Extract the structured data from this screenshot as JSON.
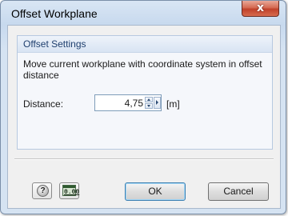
{
  "window": {
    "title": "Offset Workplane",
    "close_glyph": "x"
  },
  "group": {
    "title": "Offset Settings",
    "description": "Move current workplane with coordinate system in offset distance"
  },
  "distance": {
    "label": "Distance:",
    "value": "4,75",
    "unit": "[m]"
  },
  "buttons": {
    "help_icon": "help-icon",
    "help_glyph": "?",
    "calculator_icon": "calculator-icon",
    "calculator_text": "0.00",
    "ok": "OK",
    "cancel": "Cancel"
  },
  "colors": {
    "title_bar": "#c7d9ee",
    "close_button": "#c0412a",
    "group_title": "#1f3f6e",
    "default_button_border": "#3c7fb1"
  }
}
